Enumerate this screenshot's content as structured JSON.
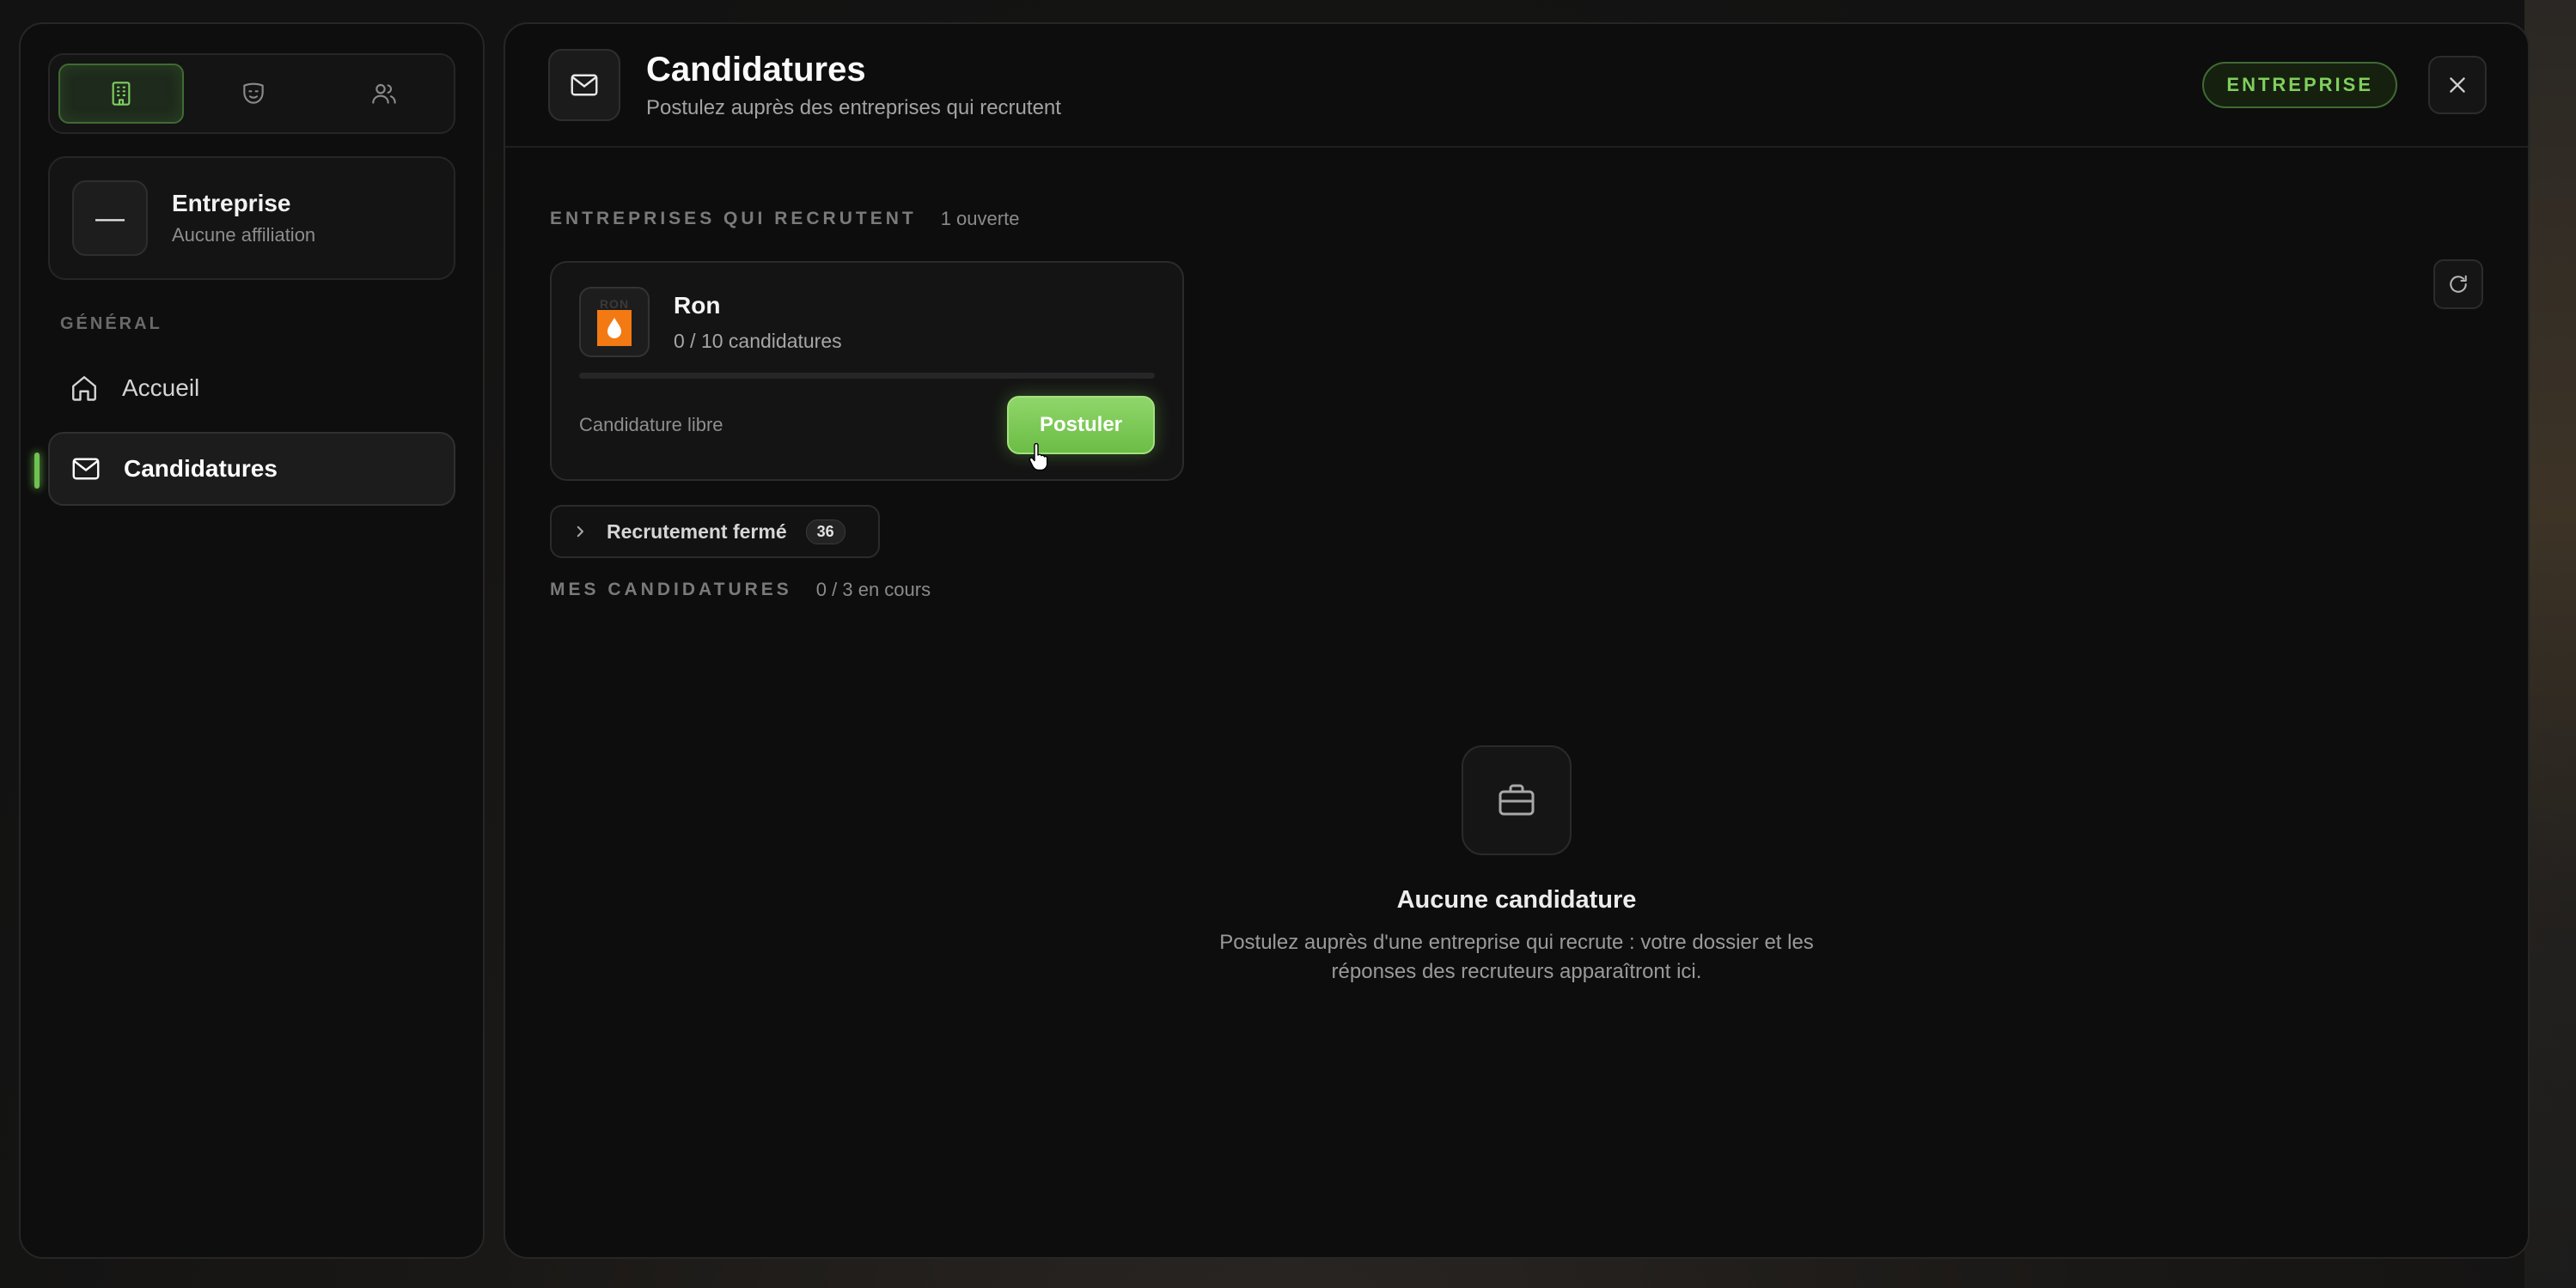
{
  "sidebar": {
    "segments": [
      {
        "icon": "building-icon",
        "active": true
      },
      {
        "icon": "mask-icon",
        "active": false
      },
      {
        "icon": "users-icon",
        "active": false
      }
    ],
    "company": {
      "logo_text": "—",
      "name": "Entreprise",
      "subtitle": "Aucune affiliation"
    },
    "section_label": "GÉNÉRAL",
    "nav": [
      {
        "icon": "home-icon",
        "label": "Accueil",
        "active": false
      },
      {
        "icon": "mail-icon",
        "label": "Candidatures",
        "active": true
      }
    ]
  },
  "header": {
    "icon": "mail-icon",
    "title": "Candidatures",
    "subtitle": "Postulez auprès des entreprises qui recrutent",
    "badge": "ENTREPRISE",
    "close_icon": "close-icon"
  },
  "recruiting": {
    "title": "ENTREPRISES QUI RECRUTENT",
    "count": "1 ouverte",
    "jobs": [
      {
        "logo_text": "RON",
        "name": "Ron",
        "applications": "0 / 10 candidatures",
        "progress": 0,
        "type": "Candidature libre",
        "apply_label": "Postuler"
      }
    ],
    "closed_label": "Recrutement fermé",
    "closed_count": "36"
  },
  "my_applications": {
    "title": "MES CANDIDATURES",
    "count": "0 / 3 en cours",
    "empty_title": "Aucune candidature",
    "empty_text": "Postulez auprès d'une entreprise qui recrute : votre dossier et les réponses des recruteurs apparaîtront ici."
  },
  "colors": {
    "accent": "#6fc24f",
    "badge_text": "#7fd05d",
    "logo_orange": "#f37a12"
  }
}
